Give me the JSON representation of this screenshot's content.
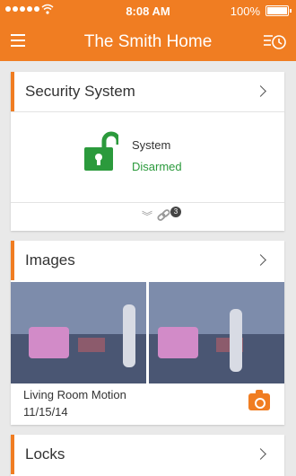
{
  "status_bar": {
    "time": "8:08 AM",
    "battery": "100%"
  },
  "header": {
    "title": "The Smith Home"
  },
  "security": {
    "title": "Security System",
    "system_label": "System",
    "state": "Disarmed",
    "linked_count": "3"
  },
  "images": {
    "title": "Images",
    "caption_title": "Living Room Motion",
    "caption_date": "11/15/14"
  },
  "locks": {
    "title": "Locks"
  },
  "colors": {
    "accent": "#f07d22",
    "armed_state": "#2b9a3c"
  },
  "icons": [
    "menu-icon",
    "history-icon",
    "chevron-right-icon",
    "unlocked-padlock-icon",
    "expand-down-icon",
    "link-icon",
    "camera-icon"
  ]
}
